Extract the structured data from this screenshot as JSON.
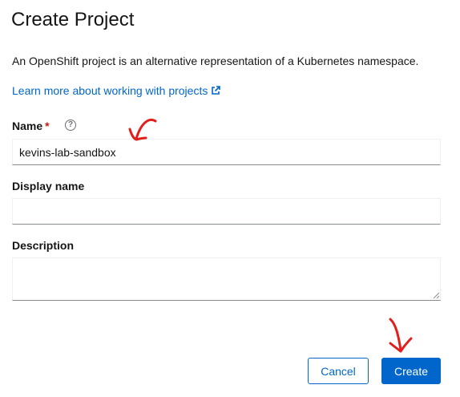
{
  "dialog": {
    "title": "Create Project",
    "description": "An OpenShift project is an alternative representation of a Kubernetes namespace.",
    "learn_more_link": "Learn more about working with projects"
  },
  "form": {
    "name": {
      "label": "Name",
      "required_marker": "*",
      "help_icon": "question-circle-icon",
      "value": "kevins-lab-sandbox"
    },
    "display_name": {
      "label": "Display name",
      "value": ""
    },
    "description": {
      "label": "Description",
      "value": ""
    }
  },
  "actions": {
    "cancel_label": "Cancel",
    "create_label": "Create"
  },
  "colors": {
    "link": "#0066cc",
    "primary": "#0066cc",
    "required": "#c9190b",
    "annotation": "#e0201c"
  },
  "icons": {
    "external_link": "external-link-icon",
    "help": "question-circle-icon"
  }
}
